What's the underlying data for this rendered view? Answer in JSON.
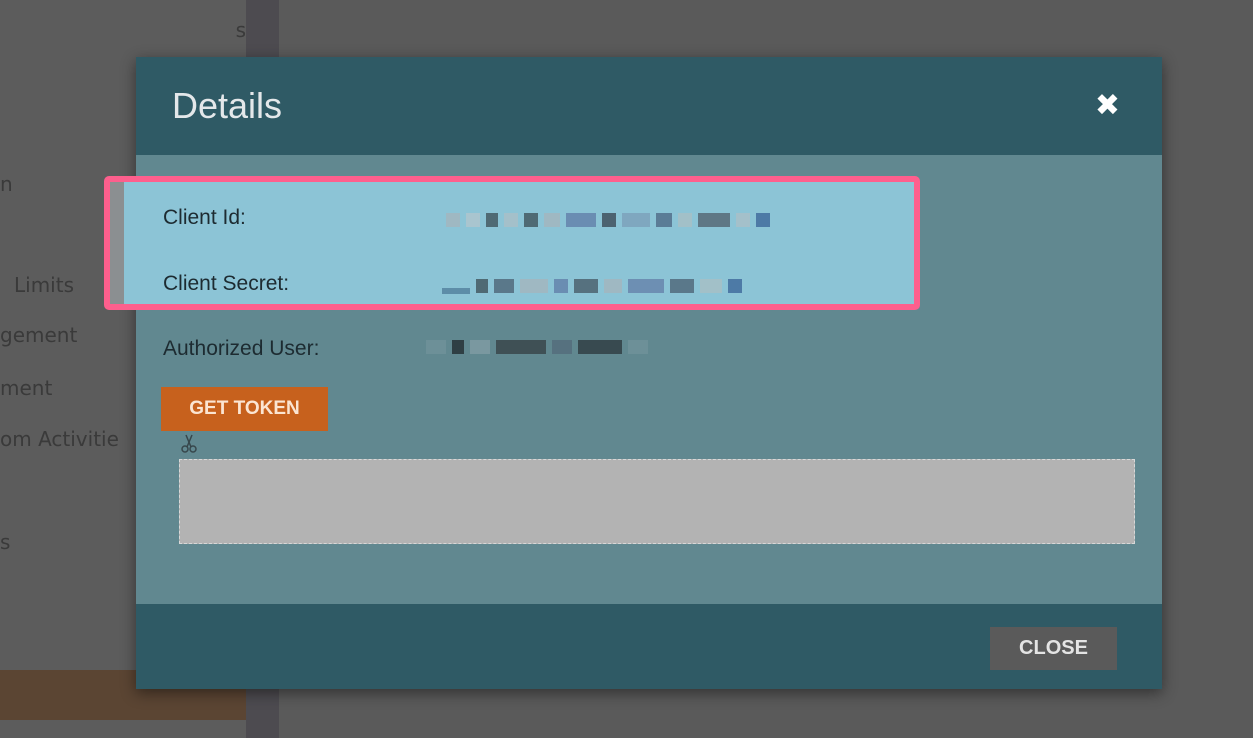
{
  "background": {
    "nav_items": [
      "s",
      "n",
      "Limits",
      "gement",
      "ment",
      "om Activitie",
      "s"
    ]
  },
  "modal": {
    "title": "Details",
    "close_icon": "close-icon",
    "fields": {
      "client_id_label": "Client Id:",
      "client_secret_label": "Client Secret:",
      "authorized_user_label": "Authorized User:"
    },
    "get_token_label": "GET TOKEN",
    "copy_icon": "scissors-icon",
    "token_value": "",
    "close_label": "CLOSE"
  },
  "colors": {
    "highlight_border": "#fd5f8d",
    "header": "#2f5a65",
    "get_token_button": "#c7611d"
  }
}
